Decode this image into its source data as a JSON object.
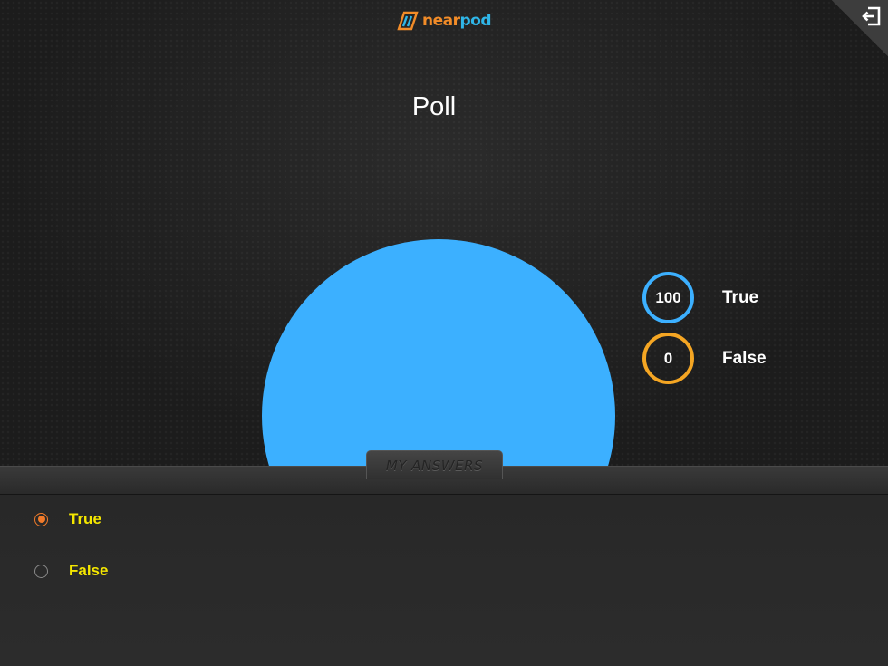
{
  "header": {
    "logo_text_a": "near",
    "logo_text_b": "pod",
    "exit_icon": "exit-icon"
  },
  "main": {
    "title": "Poll"
  },
  "chart_data": {
    "type": "pie",
    "categories": [
      "True",
      "False"
    ],
    "values": [
      100,
      0
    ],
    "colors": [
      "#3cb0ff",
      "#f5a623"
    ],
    "legend_position": "right"
  },
  "answers": {
    "tab_label": "MY ANSWERS",
    "options": [
      {
        "label": "True",
        "selected": true
      },
      {
        "label": "False",
        "selected": false
      }
    ]
  },
  "colors": {
    "true_accent": "#3cb0ff",
    "false_accent": "#f5a623",
    "option_text": "#f4e600",
    "radio_selected": "#f07a2a"
  }
}
